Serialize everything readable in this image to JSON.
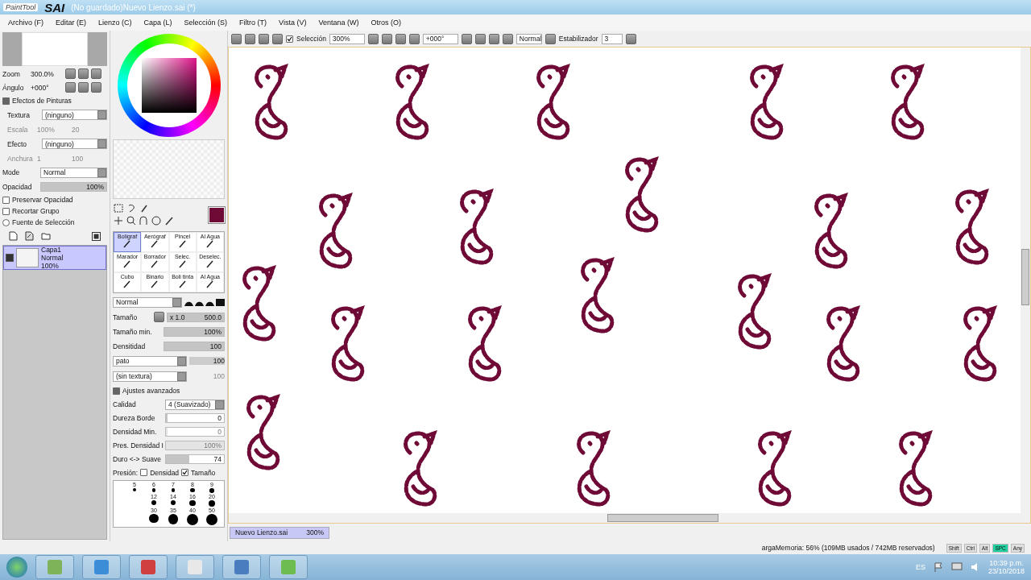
{
  "window": {
    "logo_small": "PaintTool",
    "logo_big": "SAI",
    "title": "(No guardado)Nuevo Lienzo.sai (*)"
  },
  "menu": [
    "Archivo (F)",
    "Editar (E)",
    "Lienzo (C)",
    "Capa (L)",
    "Selección (S)",
    "Filtro (T)",
    "Vista (V)",
    "Ventana (W)",
    "Otros (O)"
  ],
  "navigator": {
    "zoom_label": "Zoom",
    "zoom_value": "300.0%",
    "angle_label": "Ángulo",
    "angle_value": "+000°"
  },
  "paint_effects": {
    "title": "Efectos de Pinturas",
    "expanded": true,
    "rows": [
      {
        "label": "Textura",
        "value": "(ninguno)",
        "sub_label": "Escala",
        "sub_value_1": "100%",
        "sub_value_2": "20"
      },
      {
        "label": "Efecto",
        "value": "(ninguno)",
        "sub_label": "Anchura",
        "sub_value_1": "1",
        "sub_value_2": "100"
      }
    ]
  },
  "layer_props": {
    "mode_label": "Mode",
    "mode_value": "Normal",
    "opacity": {
      "label": "Opacidad",
      "value": "100%",
      "level": 1
    },
    "options": [
      {
        "label": "Preservar Opacidad",
        "checked": false,
        "kind": "checkbox"
      },
      {
        "label": "Recortar Grupo",
        "checked": false,
        "kind": "checkbox"
      },
      {
        "label": "Fuente de Selección",
        "checked": false,
        "kind": "radio"
      }
    ]
  },
  "layers": [
    {
      "name": "Capa1",
      "mode": "Normal",
      "opacity": "100%",
      "selected": true,
      "visible": true
    }
  ],
  "tools": [
    {
      "label": "Bolígraf",
      "selected": true
    },
    {
      "label": "Aerógraf",
      "selected": false
    },
    {
      "label": "Pincel",
      "selected": false
    },
    {
      "label": "Al Agua",
      "selected": false
    },
    {
      "label": "Marador",
      "selected": false
    },
    {
      "label": "Borrador",
      "selected": false
    },
    {
      "label": "Selec.",
      "selected": false
    },
    {
      "label": "Deselec.",
      "selected": false
    },
    {
      "label": "Cubo",
      "selected": false
    },
    {
      "label": "Binario",
      "selected": false
    },
    {
      "label": "Boli tinta",
      "selected": false
    },
    {
      "label": "Al Agua",
      "selected": false
    }
  ],
  "brush": {
    "mode": "Normal",
    "size": {
      "label": "Tamaño",
      "multiplier": "x 1.0",
      "value": "500.0",
      "level": 1
    },
    "min_size": {
      "label": "Tamaño min.",
      "value": "100%",
      "level": 1
    },
    "density": {
      "label": "Densitidad",
      "value": "100",
      "level": 1
    },
    "shape": "pato",
    "shape_value": "100",
    "texture": "(sin textura)",
    "texture_value": "100"
  },
  "advanced": {
    "title": "Ajustes avanzados",
    "expanded": true,
    "rows": [
      {
        "kind": "select",
        "label": "Calidad",
        "value": "4 (Suavizado)"
      },
      {
        "kind": "slider",
        "label": "Dureza Borde",
        "value": "0",
        "level": 0,
        "disabled": false
      },
      {
        "kind": "slider",
        "label": "Densidad Min.",
        "value": "0",
        "level": 0,
        "disabled": true
      },
      {
        "kind": "slider",
        "label": "Pres. Densidad I",
        "value": "100%",
        "level": 1,
        "disabled": true
      },
      {
        "kind": "slider",
        "label": "Duro <-> Suave",
        "value": "74",
        "level": 0.4,
        "disabled": false
      }
    ],
    "pressure_label": "Presión:",
    "pressure": [
      {
        "label": "Densidad",
        "checked": false
      },
      {
        "label": "Tamaño",
        "checked": true
      }
    ]
  },
  "brush_sizes": [
    [
      "5",
      "6",
      "7",
      "8",
      "9"
    ],
    [
      "12",
      "14",
      "16",
      "20"
    ],
    [
      "30",
      "35",
      "40",
      "50"
    ]
  ],
  "toolbar": {
    "selection_label": "Selección",
    "selection_checked": true,
    "zoom": "300%",
    "angle": "+000°",
    "mode": "Normal",
    "stabilizer_label": "Estabilizador",
    "stabilizer_value": "3"
  },
  "canvas_tabs": [
    {
      "name": "Nuevo Lienzo.sai",
      "zoom": "300%",
      "selected": true
    }
  ],
  "status": {
    "memory": "argaMemoria: 56% (109MB usados / 742MB reservados)",
    "keys": [
      {
        "label": "Shift",
        "on": false
      },
      {
        "label": "Ctrl",
        "on": false
      },
      {
        "label": "Alt",
        "on": false
      },
      {
        "label": "SPC",
        "on": true
      },
      {
        "label": "Any",
        "on": false
      }
    ]
  },
  "taskbar": {
    "language": "ES",
    "time": "10:39 p.m.",
    "date": "23/10/2018"
  }
}
